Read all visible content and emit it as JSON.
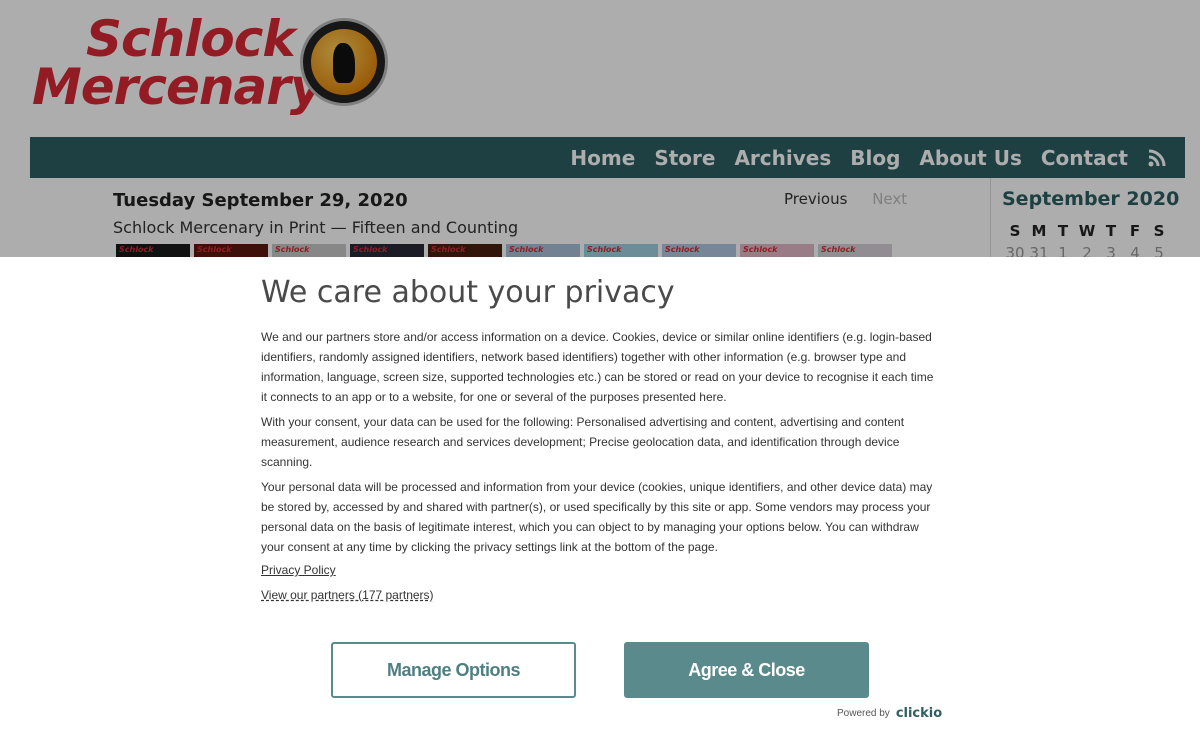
{
  "logo": {
    "line1": "Schlock",
    "line2": "Mercenary"
  },
  "nav": {
    "items": [
      "Home",
      "Store",
      "Archives",
      "Blog",
      "About Us",
      "Contact"
    ],
    "rss_icon": "rss-icon"
  },
  "post": {
    "date": "Tuesday September 29, 2020",
    "title": "Schlock Mercenary in Print — Fifteen and Counting",
    "previous_label": "Previous",
    "next_label": "Next",
    "thumbnail_label": "Schlock"
  },
  "calendar": {
    "title": "September 2020",
    "weekdays": [
      "S",
      "M",
      "T",
      "W",
      "T",
      "F",
      "S"
    ],
    "first_row": [
      "30",
      "31",
      "1",
      "2",
      "3",
      "4",
      "5"
    ]
  },
  "consent": {
    "title": "We care about your privacy",
    "paragraphs": [
      "We and our partners store and/or access information on a device. Cookies, device or similar online identifiers (e.g. login-based identifiers, randomly assigned identifiers, network based identifiers) together with other information (e.g. browser type and information, language, screen size, supported technologies etc.) can be stored or read on your device to recognise it each time it connects to an app or to a website, for one or several of the purposes presented here.",
      "With your consent, your data can be used for the following: Personalised advertising and content, advertising and content measurement, audience research and services development; Precise geolocation data, and identification through device scanning.",
      "Your personal data will be processed and information from your device (cookies, unique identifiers, and other device data) may be stored by, accessed by and shared with partner(s), or used specifically by this site or app. Some vendors may process your personal data on the basis of legitimate interest, which you can object to by managing your options below. You can withdraw your consent at any time by clicking the privacy settings link at the bottom of the page."
    ],
    "privacy_policy_link": "Privacy Policy",
    "partners_link": "View our partners (177 partners)",
    "manage_button": "Manage Options",
    "agree_button": "Agree & Close",
    "powered_by": "Powered by",
    "brand": "clickio"
  },
  "colors": {
    "nav_bg": "#2f5f64",
    "accent": "#5b8a8c",
    "logo_red": "#d92a35"
  }
}
